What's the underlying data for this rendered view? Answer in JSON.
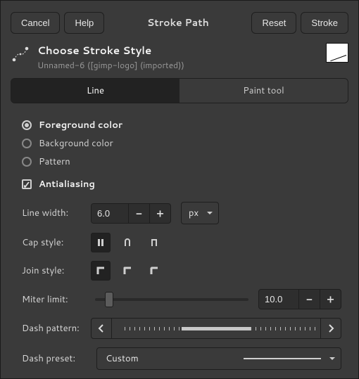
{
  "dialog": {
    "cancel": "Cancel",
    "help": "Help",
    "title": "Stroke Path",
    "reset": "Reset",
    "stroke": "Stroke"
  },
  "header": {
    "title": "Choose Stroke Style",
    "subtitle": "Unnamed-6 ([gimp-logo] (imported))"
  },
  "tabs": {
    "line": "Line",
    "paint": "Paint tool"
  },
  "radios": {
    "fg": "Foreground color",
    "bg": "Background color",
    "pattern": "Pattern"
  },
  "antialias": {
    "label": "Antialiasing"
  },
  "linewidth": {
    "label": "Line width:",
    "value": "6.0",
    "unit": "px"
  },
  "capstyle": {
    "label": "Cap style:"
  },
  "joinstyle": {
    "label": "Join style:"
  },
  "miter": {
    "label": "Miter limit:",
    "value": "10.0"
  },
  "dashpattern": {
    "label": "Dash pattern:"
  },
  "dashpreset": {
    "label": "Dash preset:",
    "value": "Custom"
  }
}
